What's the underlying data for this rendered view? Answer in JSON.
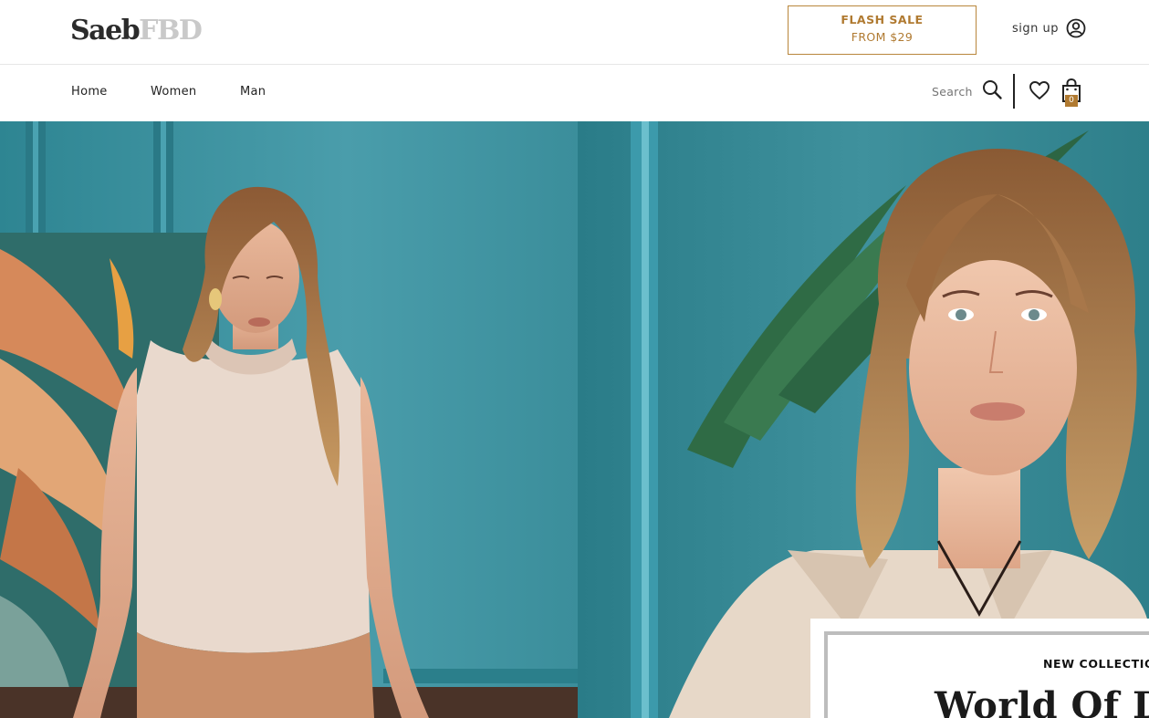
{
  "brand": {
    "name_part1": "Saeb",
    "name_part2": "FBD"
  },
  "flash_sale": {
    "line1": "FLASH SALE",
    "line2": "FROM $29"
  },
  "account": {
    "signup_label": "sign up",
    "icon": "user-circle-icon"
  },
  "nav": {
    "items": [
      {
        "label": "Home"
      },
      {
        "label": "Women"
      },
      {
        "label": "Man"
      }
    ]
  },
  "search": {
    "placeholder": "Search",
    "icon": "search-icon"
  },
  "wishlist": {
    "icon": "heart-icon"
  },
  "cart": {
    "icon": "shopping-bag-icon",
    "count": "0"
  },
  "hero": {
    "promo_kicker": "NEW COLLECTION",
    "promo_title": "World Of D"
  },
  "colors": {
    "accent": "#b07a31",
    "teal": "#3a8f9c",
    "teal_dark": "#2f7e89"
  }
}
